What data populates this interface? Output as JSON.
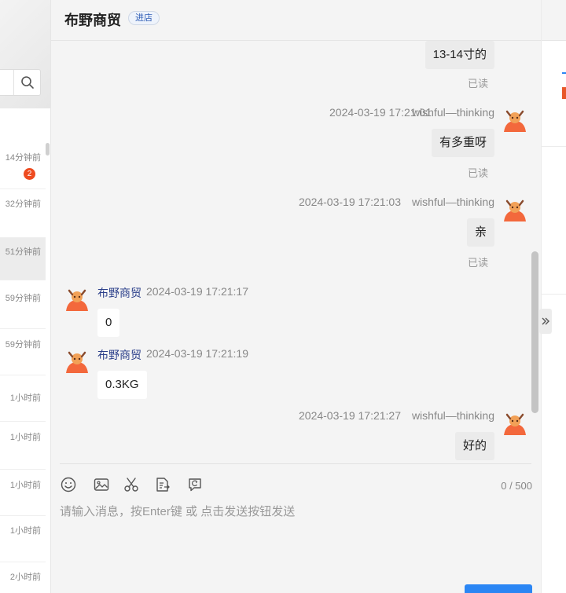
{
  "left_panel": {
    "conversations": [
      {
        "time": "14分钟前",
        "unread": "2"
      },
      {
        "time": "32分钟前"
      },
      {
        "time": "51分钟前"
      },
      {
        "time": "59分钟前"
      },
      {
        "time": "59分钟前"
      },
      {
        "time": "1小时前"
      },
      {
        "time": "1小时前"
      },
      {
        "time": "1小时前"
      },
      {
        "time": "1小时前"
      },
      {
        "time": "2小时前"
      }
    ]
  },
  "chat": {
    "shop_name": "布野商贸",
    "enter_shop_label": "进店",
    "messages": [
      {
        "text": "13-14寸的",
        "status": "已读"
      },
      {
        "timestamp": "2024-03-19 17:21:01",
        "sender": "wishful—thinking",
        "text": "有多重呀",
        "status": "已读"
      },
      {
        "timestamp": "2024-03-19 17:21:03",
        "sender": "wishful—thinking",
        "text": "亲",
        "status": "已读"
      },
      {
        "sender": "布野商贸",
        "timestamp": "2024-03-19 17:21:17",
        "text": "0"
      },
      {
        "sender": "布野商贸",
        "timestamp": "2024-03-19 17:21:19",
        "text": "0.3KG"
      },
      {
        "timestamp": "2024-03-19 17:21:27",
        "sender": "wishful—thinking",
        "text": "好的"
      }
    ],
    "char_count": "0 / 500",
    "input_placeholder": "请输入消息，按Enter键 或 点击发送按钮发送",
    "send_label": ""
  },
  "colors": {
    "accent": "#2b86f4",
    "badge": "#ee4b20",
    "sender_name": "#2b3f8a"
  }
}
